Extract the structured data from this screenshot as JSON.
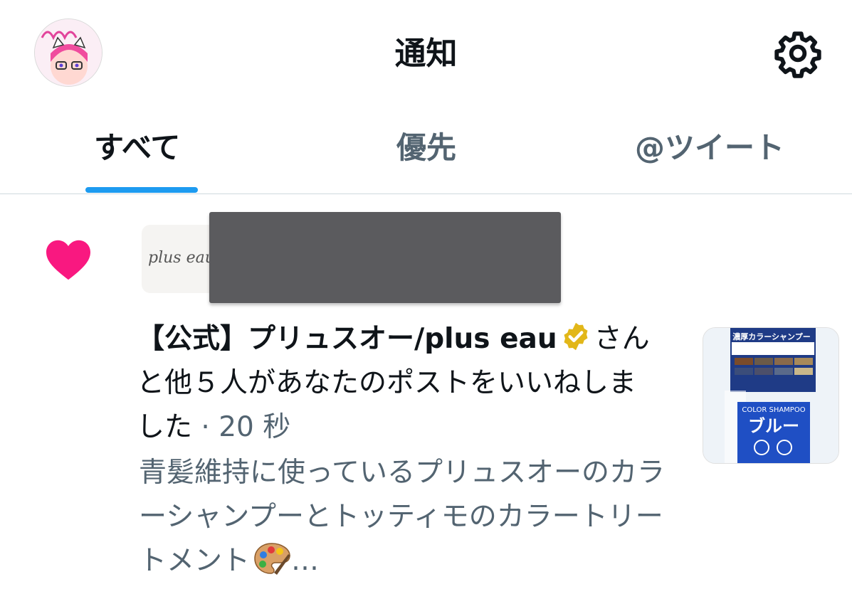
{
  "header": {
    "title": "通知",
    "avatar_icon": "user-avatar",
    "settings_icon": "gear-icon"
  },
  "tabs": [
    {
      "label": "すべて",
      "active": true
    },
    {
      "label": "優先",
      "active": false
    },
    {
      "label": "@ツイート",
      "active": false
    }
  ],
  "notification": {
    "type_icon": "heart-icon",
    "actor_avatar_logo": "plus eau",
    "actor_name": "【公式】プリュスオー/plus eau",
    "verified_badge": "gold-verified-icon",
    "action_text": "さんと他５人があなたのポストをいいねしました",
    "separator": " · ",
    "time": "20 秒",
    "tweet_text": "青髪維持に使っているプリュスオーのカラーシャンプーとトッティモのカラートリートメント",
    "tweet_emoji": "palette-emoji",
    "ellipsis": "…",
    "thumbnail": {
      "banner": "濃厚カラーシャンプー",
      "label": "COLOR SHAMPOO",
      "product": "ブルー"
    }
  },
  "colors": {
    "accent": "#1d9bf0",
    "like": "#f91880",
    "secondary_text": "#536471",
    "verified_gold": "#e2b719"
  }
}
